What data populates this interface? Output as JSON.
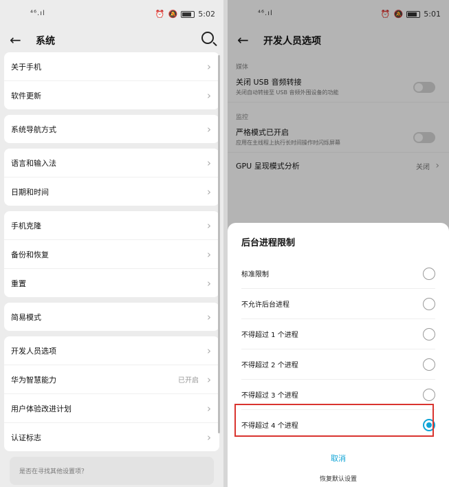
{
  "left": {
    "status": {
      "signal": "⁴⁶.ıl",
      "time": "5:02"
    },
    "title": "系统",
    "groups": [
      [
        {
          "label": "关于手机"
        },
        {
          "label": "软件更新"
        }
      ],
      [
        {
          "label": "系统导航方式"
        }
      ],
      [
        {
          "label": "语言和输入法"
        },
        {
          "label": "日期和时间"
        }
      ],
      [
        {
          "label": "手机克隆"
        },
        {
          "label": "备份和恢复"
        },
        {
          "label": "重置"
        }
      ],
      [
        {
          "label": "简易模式"
        }
      ],
      [
        {
          "label": "开发人员选项"
        },
        {
          "label": "华为智慧能力",
          "meta": "已开启"
        },
        {
          "label": "用户体验改进计划"
        },
        {
          "label": "认证标志"
        }
      ]
    ],
    "search_hint": "是否在寻找其他设置项？"
  },
  "right": {
    "status": {
      "signal": "⁴⁶.ıl",
      "time": "5:01"
    },
    "title": "开发人员选项",
    "media_section": "媒体",
    "usb": {
      "title": "关闭 USB 音频转接",
      "subtitle": "关闭自动转接至 USB 音频外围设备的功能"
    },
    "monitor_section": "监控",
    "strict": {
      "title": "严格模式已开启",
      "subtitle": "应用在主线程上执行长时间操作时闪烁屏幕"
    },
    "gpu": {
      "title": "GPU 呈现模式分析",
      "meta": "关闭"
    },
    "dialog": {
      "title": "后台进程限制",
      "options": [
        {
          "label": "标准限制",
          "selected": false
        },
        {
          "label": "不允许后台进程",
          "selected": false
        },
        {
          "label": "不得超过 1 个进程",
          "selected": false
        },
        {
          "label": "不得超过 2 个进程",
          "selected": false
        },
        {
          "label": "不得超过 3 个进程",
          "selected": false
        },
        {
          "label": "不得超过 4 个进程",
          "selected": true
        }
      ],
      "cancel": "取消"
    },
    "reset": "恢复默认设置"
  },
  "colors": {
    "accent": "#0fa4d6",
    "highlight": "#d9332e"
  }
}
